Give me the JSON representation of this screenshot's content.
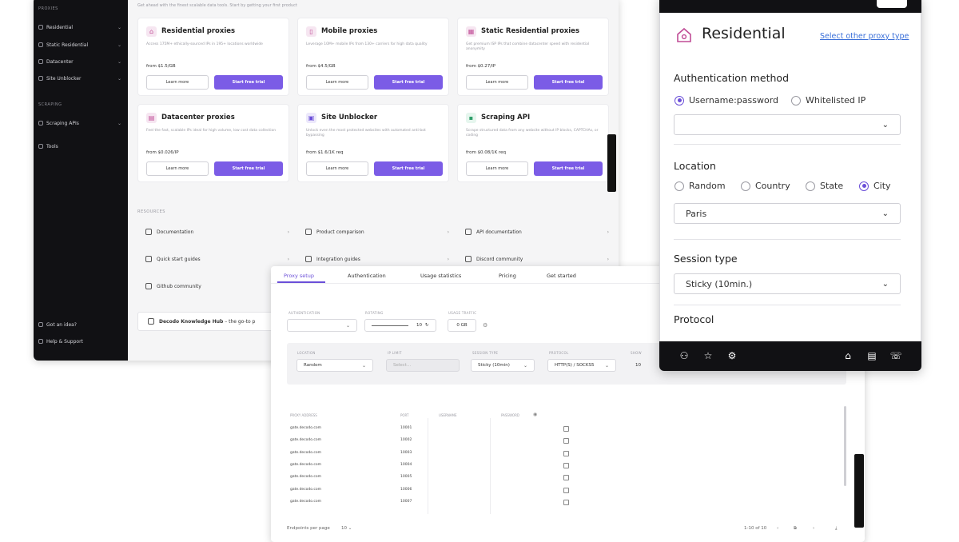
{
  "dashboard": {
    "subtitle": "Get ahead with the finest scalable data tools. Start by getting your first product",
    "sidebar": {
      "section_proxies": "PROXIES",
      "proxy_items": [
        "Residential",
        "Static Residential",
        "Datacenter",
        "Site Unblocker"
      ],
      "section_scraping": "SCRAPING",
      "scraping_items": [
        "Scraping APIs",
        "Tools"
      ],
      "bottom_items": [
        "Got an idea?",
        "Help & Support"
      ]
    },
    "cards": [
      {
        "title": "Residential proxies",
        "desc": "Access 175M+ ethically-sourced IPs in 195+ locations worldwide",
        "price": "from $1.5/GB",
        "learn": "Learn more",
        "trial": "Start free trial",
        "icon": "home-icon"
      },
      {
        "title": "Mobile proxies",
        "desc": "Leverage 10M+ mobile IPs from 130+ carriers for high data quality",
        "price": "from $4.5/GB",
        "learn": "Learn more",
        "trial": "Start free trial",
        "icon": "phone-icon"
      },
      {
        "title": "Static Residential proxies",
        "desc": "Get premium ISP IPs that combine datacenter speed with residential anonymity",
        "price": "from $0.27/IP",
        "learn": "Learn more",
        "trial": "Start free trial",
        "icon": "building-icon"
      },
      {
        "title": "Datacenter proxies",
        "desc": "Feel the fast, scalable IPs ideal for high volume, low cost data collection",
        "price": "from $0.026/IP",
        "learn": "Learn more",
        "trial": "Start free trial",
        "icon": "server-icon"
      },
      {
        "title": "Site Unblocker",
        "desc": "Unlock even the most protected websites with automated anti-bot bypassing",
        "price": "from $1.6/1K req",
        "learn": "Learn more",
        "trial": "Start free trial",
        "icon": "unlock-icon"
      },
      {
        "title": "Scraping API",
        "desc": "Scrape structured data from any website without IP blocks, CAPTCHAs, or coding",
        "price": "from $0.08/1K req",
        "learn": "Learn more",
        "trial": "Start free trial",
        "icon": "code-icon"
      }
    ],
    "resources_label": "RESOURCES",
    "resources": [
      "Documentation",
      "Product comparison",
      "API documentation",
      "Quick start guides",
      "Integration guides",
      "Discord community",
      "Github community"
    ],
    "hub_bold": "Decodo Knowledge Hub",
    "hub_rest": " – the go-to p",
    "side_tab": "Documentation"
  },
  "setup": {
    "tabs": [
      "Proxy setup",
      "Authentication",
      "Usage statistics",
      "Pricing",
      "Get started"
    ],
    "auth_user_label": "AUTHENTICATION",
    "session_label": "SESSION TYPE",
    "location_label": "LOCATION",
    "ip_label": "IP LIMIT",
    "protocol_label": "PROTOCOL",
    "rotation_label": "ROTATING",
    "rows_label": "SHOW",
    "slider_value": "10",
    "traffic_label": "USAGE TRAFFIC",
    "traffic_value": "0 GB",
    "location_value": "Random",
    "city_placeholder": "Select...",
    "session_value": "Sticky (10min)",
    "protocol_value": "HTTP(S) / SOCKS5",
    "count_value": "10",
    "columns": [
      "PROXY ADDRESS",
      "PORT",
      "USERNAME",
      "PASSWORD"
    ],
    "rows": [
      {
        "host": "gate.decodo.com",
        "port": "10001"
      },
      {
        "host": "gate.decodo.com",
        "port": "10002"
      },
      {
        "host": "gate.decodo.com",
        "port": "10003"
      },
      {
        "host": "gate.decodo.com",
        "port": "10004"
      },
      {
        "host": "gate.decodo.com",
        "port": "10005"
      },
      {
        "host": "gate.decodo.com",
        "port": "10006"
      },
      {
        "host": "gate.decodo.com",
        "port": "10007"
      }
    ],
    "per_page_label": "Endpoints per page",
    "per_page_value": "10",
    "pagination": "1-10 of 10"
  },
  "extension": {
    "title": "Residential",
    "switch_link": "Select other proxy type",
    "auth_heading": "Authentication method",
    "auth_options": [
      "Username:password",
      "Whitelisted IP"
    ],
    "auth_selected": 0,
    "auth_select_value": "",
    "location_heading": "Location",
    "location_options": [
      "Random",
      "Country",
      "State",
      "City"
    ],
    "location_selected": 3,
    "city_value": "Paris",
    "session_heading": "Session type",
    "session_value": "Sticky (10min.)",
    "protocol_heading": "Protocol",
    "bottom_icons": [
      "users-icon",
      "star-icon",
      "gear-icon",
      "home-icon",
      "document-icon",
      "chat-icon"
    ],
    "accent": "#6b4fd8"
  }
}
